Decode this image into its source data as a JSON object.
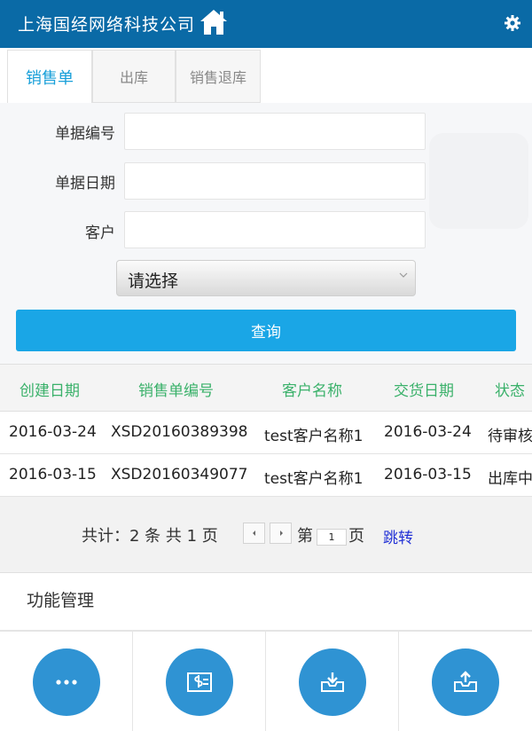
{
  "header": {
    "title": "上海国经网络科技公司",
    "home_icon": "home-icon",
    "settings_icon": "gear-icon"
  },
  "tabs": [
    {
      "label": "销售单",
      "active": true
    },
    {
      "label": "出库",
      "active": false
    },
    {
      "label": "销售退库",
      "active": false
    }
  ],
  "form": {
    "doc_number_label": "单据编号",
    "doc_number_value": "",
    "doc_date_label": "单据日期",
    "doc_date_value": "",
    "customer_label": "客户",
    "customer_value": "",
    "select_value": "请选择",
    "query_button": "查询"
  },
  "table": {
    "columns": [
      "创建日期",
      "销售单编号",
      "客户名称",
      "交货日期",
      "状态"
    ],
    "rows": [
      [
        "2016-03-24",
        "XSD20160389398",
        "test客户名称1",
        "2016-03-24",
        "待审核"
      ],
      [
        "2016-03-15",
        "XSD20160349077",
        "test客户名称1",
        "2016-03-15",
        "出库中"
      ]
    ]
  },
  "pager": {
    "summary": "共计：2 条 共 1 页",
    "page_prefix": "第",
    "page_value": "1",
    "page_suffix": "页",
    "jump": "跳转"
  },
  "section": {
    "title": "功能管理"
  },
  "functions": [
    {
      "icon": "more-icon"
    },
    {
      "icon": "receipt-icon"
    },
    {
      "icon": "inbox-in-icon"
    },
    {
      "icon": "inbox-out-icon"
    }
  ],
  "colors": {
    "header": "#0a6aa6",
    "accent": "#1aa6e6",
    "column_header": "#3ab16a",
    "icon_circle": "#2f93d3"
  }
}
